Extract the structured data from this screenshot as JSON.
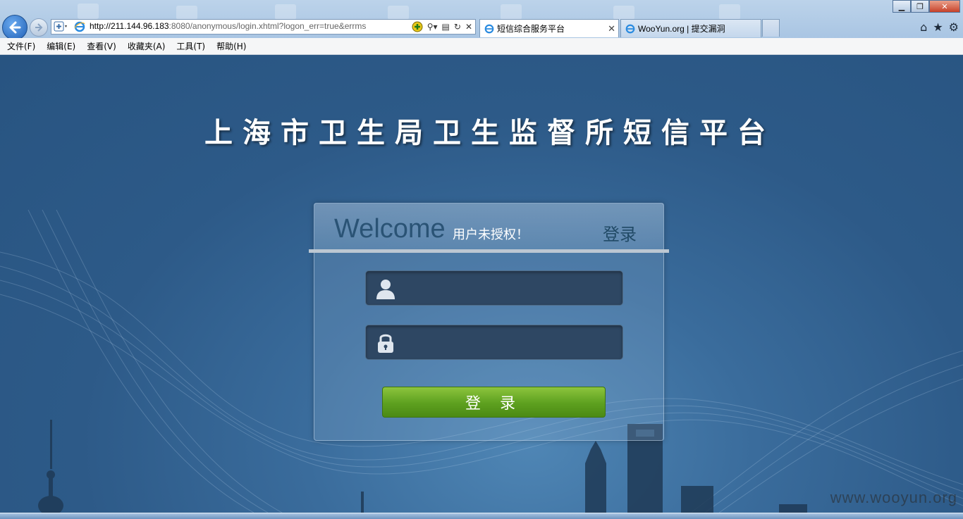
{
  "browser": {
    "url_host": "http://211.144.96.183",
    "url_rest": ":8080/anonymous/login.xhtml?logon_err=true&errms",
    "tabs": [
      {
        "label": "短信综合服务平台",
        "active": true
      },
      {
        "label": "WooYun.org | 提交漏洞",
        "active": false
      }
    ],
    "menu": [
      "文件(F)",
      "编辑(E)",
      "查看(V)",
      "收藏夹(A)",
      "工具(T)",
      "帮助(H)"
    ]
  },
  "page": {
    "title": "上海市卫生局卫生监督所短信平台",
    "panel": {
      "welcome": "Welcome",
      "error_message": "用户未授权！",
      "header_login": "登录"
    },
    "form": {
      "username_value": "",
      "password_value": "",
      "login_button": "登 录"
    },
    "watermark": "www.wooyun.org"
  },
  "colors": {
    "background": "#2f5f8d",
    "login_button": "#6aaa24",
    "field_bg": "#2e4763"
  }
}
